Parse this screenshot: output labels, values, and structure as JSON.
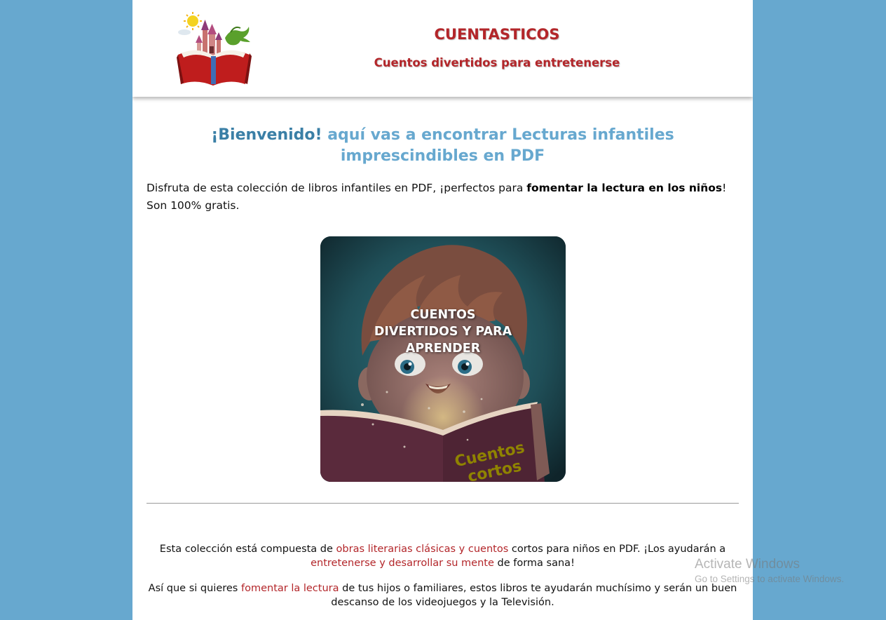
{
  "header": {
    "logo_icon": "storybook-castle-dragon-icon",
    "site_title": "CUENTASTICOS",
    "site_tagline": "Cuentos divertidos para entretenerse"
  },
  "welcome": {
    "strong": "¡Bienvenido!",
    "rest": " aquí vas a encontrar Lecturas infantiles imprescindibles en PDF"
  },
  "intro": {
    "text_before": "Disfruta de esta colección de libros infantiles en PDF, ¡perfectos para ",
    "bold": "fomentar la lectura en los niños",
    "text_after": "! Son 100% gratis."
  },
  "hero": {
    "line1": "CUENTOS",
    "line2": "DIVERTIDOS Y PARA",
    "line3": "APRENDER",
    "book_text_1": "Cuentos",
    "book_text_2": "cortos"
  },
  "collection": {
    "t1": "Esta colección está compuesta de ",
    "l1": "obras literarias clásicas y cuentos",
    "t2": " cortos para niños en PDF. ¡Los ayudarán a ",
    "l2": "entretenerse y desarrollar su mente",
    "t3": " de forma sana!"
  },
  "reading": {
    "t1": "Así que si quieres ",
    "l1": "fomentar la lectura",
    "t2": " de tus hijos o familiares, estos libros te ayudarán muchísimo y serán un buen descanso de los videojuegos y la Televisión."
  },
  "watermark": {
    "title": "Activate Windows",
    "subtitle": "Go to Settings to activate Windows."
  },
  "colors": {
    "page_background": "#67a8cf",
    "accent_red": "#b3262a",
    "heading_blue": "#67a8cf",
    "heading_blue_dark": "#3a7fa6"
  }
}
